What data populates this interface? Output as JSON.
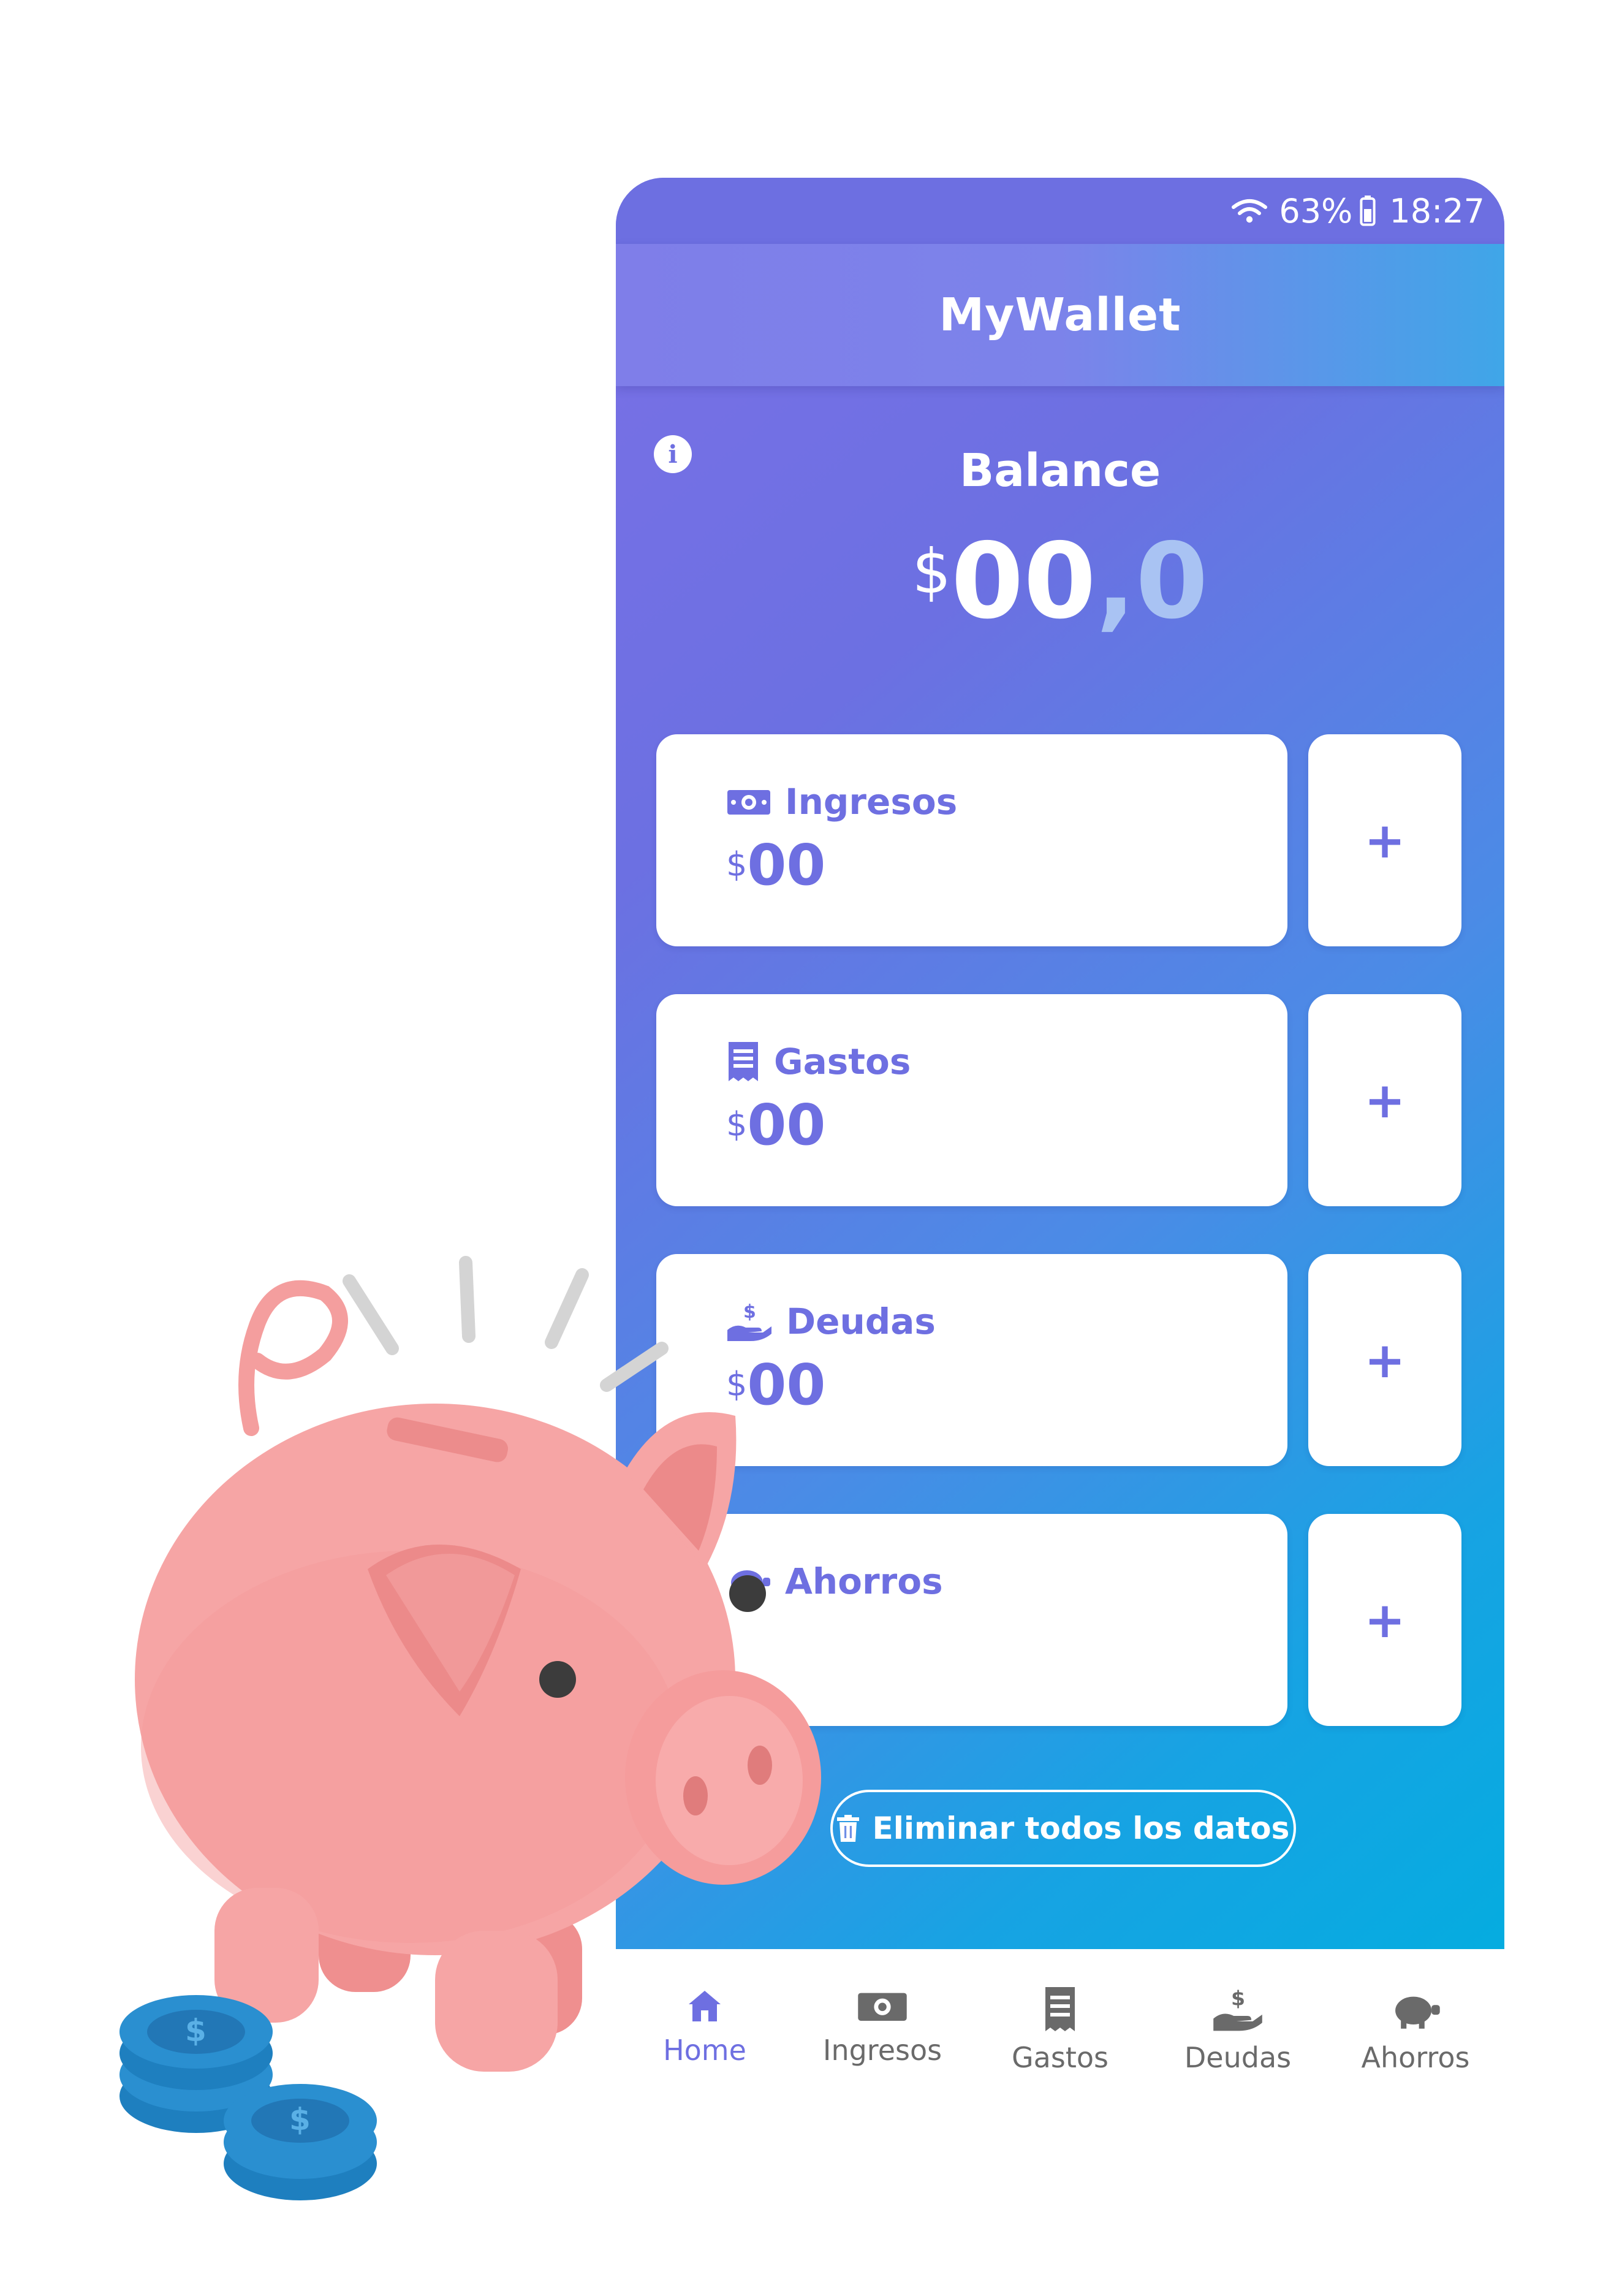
{
  "status": {
    "battery": "63%",
    "time": "18:27"
  },
  "app": {
    "title": "MyWallet"
  },
  "balance": {
    "label": "Balance",
    "currency": "$",
    "integer": "00",
    "decimal": ",0"
  },
  "cards": [
    {
      "label": "Ingresos",
      "currency": "$",
      "amount": "00",
      "icon": "money-icon",
      "add": "+"
    },
    {
      "label": "Gastos",
      "currency": "$",
      "amount": "00",
      "icon": "receipt-icon",
      "add": "+"
    },
    {
      "label": "Deudas",
      "currency": "$",
      "amount": "00",
      "icon": "hand-dollar-icon",
      "add": "+"
    },
    {
      "label": "Ahorros",
      "currency": "",
      "amount": "",
      "icon": "piggy-icon",
      "add": "+"
    }
  ],
  "delete_button": {
    "label": "Eliminar todos los datos",
    "icon": "trash-icon"
  },
  "nav": [
    {
      "label": "Home",
      "icon": "home-icon",
      "active": true
    },
    {
      "label": "Ingresos",
      "icon": "money-icon"
    },
    {
      "label": "Gastos",
      "icon": "receipt-icon"
    },
    {
      "label": "Deudas",
      "icon": "hand-dollar-icon"
    },
    {
      "label": "Ahorros",
      "icon": "piggy-icon"
    }
  ],
  "colors": {
    "accent": "#6e6fe1",
    "gradient_start": "#7a70e6",
    "gradient_end": "#05ace0",
    "pig": "#f4a0a0",
    "coins": "#2a8fd0"
  }
}
